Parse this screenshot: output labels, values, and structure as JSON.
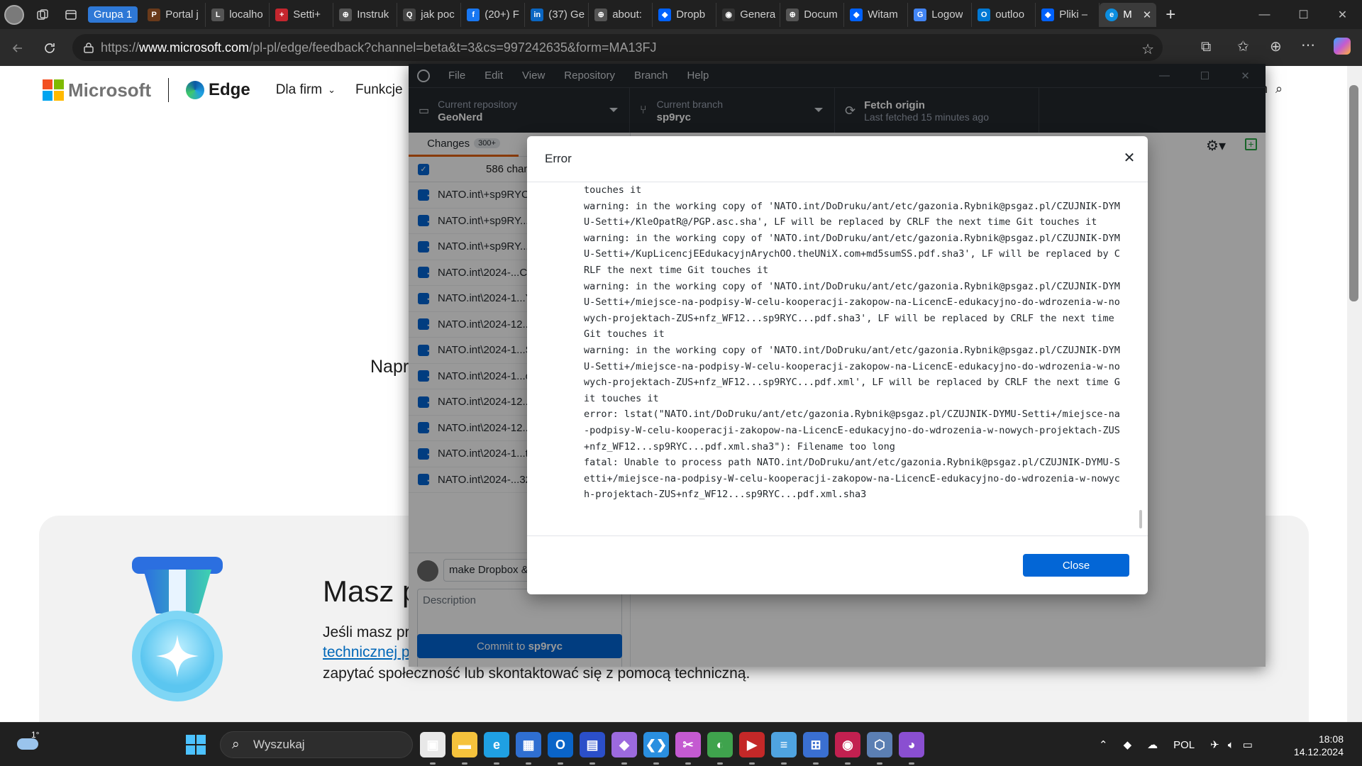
{
  "browser": {
    "group_label": "Grupa 1",
    "tabs": [
      {
        "label": "Portal j",
        "color": "#6a3a1a",
        "glyph": "P"
      },
      {
        "label": "localho",
        "color": "#555555",
        "glyph": "L"
      },
      {
        "label": "Setti+",
        "color": "#c4262e",
        "glyph": "+"
      },
      {
        "label": "Instruk",
        "color": "#555555",
        "glyph": "⊕"
      },
      {
        "label": "jak poc",
        "color": "#444444",
        "glyph": "Q"
      },
      {
        "label": "(20+) F",
        "color": "#1877f2",
        "glyph": "f"
      },
      {
        "label": "(37) Ge",
        "color": "#0a66c2",
        "glyph": "in"
      },
      {
        "label": "about:",
        "color": "#555555",
        "glyph": "⊕"
      },
      {
        "label": "Dropb",
        "color": "#0061fe",
        "glyph": "◆"
      },
      {
        "label": "Genera",
        "color": "#333333",
        "glyph": "◉"
      },
      {
        "label": "Docum",
        "color": "#555555",
        "glyph": "⊕"
      },
      {
        "label": "Witam",
        "color": "#0061fe",
        "glyph": "◆"
      },
      {
        "label": "Logow",
        "color": "#4285f4",
        "glyph": "G"
      },
      {
        "label": "outloo",
        "color": "#0078d4",
        "glyph": "O"
      },
      {
        "label": "Pliki –",
        "color": "#0061fe",
        "glyph": "◆"
      }
    ],
    "active_tab": {
      "label": "M",
      "color": "#0c8ee0",
      "glyph": "e"
    },
    "new_tab_label": "+",
    "url_prefix": "https://",
    "url_host": "www.microsoft.com",
    "url_path": "/pl-pl/edge/feedback?channel=beta&t=3&cs=997242635&form=MA13FJ"
  },
  "ms_page": {
    "brand": "Microsoft",
    "product": "Edge",
    "nav_items": [
      "Dla firm",
      "Funkcje"
    ],
    "search_fragment": "ch",
    "partial_heading": "Napr",
    "card_title": "Masz p",
    "card_line1": "Jeśli masz pr",
    "card_link": "technicznej p",
    "card_line3": "zapytać społeczność lub skontaktować się z pomocą techniczną."
  },
  "github_desktop": {
    "menus": [
      "File",
      "Edit",
      "View",
      "Repository",
      "Branch",
      "Help"
    ],
    "current_repository_label": "Current repository",
    "current_repository": "GeoNerd",
    "current_branch_label": "Current branch",
    "current_branch": "sp9ryc",
    "fetch_title": "Fetch origin",
    "fetch_sub": "Last fetched 15 minutes ago",
    "changes_tab": "Changes",
    "changes_count": "300+",
    "changes_header": "586 chang",
    "files": [
      "NATO.int\\+sp9RYC.e",
      "NATO.int\\+sp9RY...r",
      "NATO.int\\+sp9RY...u",
      "NATO.int\\2024-...Ci",
      "NATO.int\\2024-1...Y",
      "NATO.int\\2024-12...",
      "NATO.int\\2024-1...S",
      "NATO.int\\2024-1...o",
      "NATO.int\\2024-12...",
      "NATO.int\\2024-12...",
      "NATO.int\\2024-1...ta",
      "NATO.int\\2024-...32"
    ],
    "commit_summary": "make Dropbox &",
    "commit_description_placeholder": "Description",
    "commit_button_prefix": "Commit to ",
    "commit_button_branch": "sp9ryc"
  },
  "error_dialog": {
    "title": "Error",
    "lines": [
      "touches it",
      "warning: in the working copy of 'NATO.int/DoDruku/ant/etc/gazonia.Rybnik@psgaz.pl/CZUJNIK-DYMU-Setti+/KleOpatR@/PGP.asc.sha', LF will be replaced by CRLF the next time Git touches it",
      "warning: in the working copy of 'NATO.int/DoDruku/ant/etc/gazonia.Rybnik@psgaz.pl/CZUJNIK-DYMU-Setti+/KupLicencjEEdukacyjnArychOO.theUNiX.com+md5sumSS.pdf.sha3', LF will be replaced by CRLF the next time Git touches it",
      "warning: in the working copy of 'NATO.int/DoDruku/ant/etc/gazonia.Rybnik@psgaz.pl/CZUJNIK-DYMU-Setti+/miejsce-na-podpisy-W-celu-kooperacji-zakopow-na-LicencE-edukacyjno-do-wdrozenia-w-nowych-projektach-ZUS+nfz_WF12...sp9RYC...pdf.sha3', LF will be replaced by CRLF the next time Git touches it",
      "warning: in the working copy of 'NATO.int/DoDruku/ant/etc/gazonia.Rybnik@psgaz.pl/CZUJNIK-DYMU-Setti+/miejsce-na-podpisy-W-celu-kooperacji-zakopow-na-LicencE-edukacyjno-do-wdrozenia-w-nowych-projektach-ZUS+nfz_WF12...sp9RYC...pdf.xml', LF will be replaced by CRLF the next time Git touches it",
      "error: lstat(\"NATO.int/DoDruku/ant/etc/gazonia.Rybnik@psgaz.pl/CZUJNIK-DYMU-Setti+/miejsce-na-podpisy-W-celu-kooperacji-zakopow-na-LicencE-edukacyjno-do-wdrozenia-w-nowych-projektach-ZUS+nfz_WF12...sp9RYC...pdf.xml.sha3\"): Filename too long",
      "fatal: Unable to process path NATO.int/DoDruku/ant/etc/gazonia.Rybnik@psgaz.pl/CZUJNIK-DYMU-Setti+/miejsce-na-podpisy-W-celu-kooperacji-zakopow-na-LicencE-edukacyjno-do-wdrozenia-w-nowych-projektach-ZUS+nfz_WF12...sp9RYC...pdf.xml.sha3"
    ],
    "close_button": "Close"
  },
  "taskbar": {
    "weather_temp": "1°",
    "search_placeholder": "Wyszukaj",
    "language": "POL",
    "time": "18:08",
    "date": "14.12.2024",
    "apps": [
      {
        "name": "task-view-icon",
        "color": "#e8e8e8",
        "glyph": "▣"
      },
      {
        "name": "file-explorer-icon",
        "color": "#f5c23c",
        "glyph": "▬"
      },
      {
        "name": "edge-icon",
        "color": "#1fa0e3",
        "glyph": "e"
      },
      {
        "name": "store-icon",
        "color": "#2f6fd1",
        "glyph": "▦"
      },
      {
        "name": "outlook-icon",
        "color": "#0a64c8",
        "glyph": "O"
      },
      {
        "name": "save-app-icon",
        "color": "#2b4fc9",
        "glyph": "▤"
      },
      {
        "name": "paint-app-icon",
        "color": "#9c6ade",
        "glyph": "◆"
      },
      {
        "name": "vscode-icon",
        "color": "#2a8fe0",
        "glyph": "❮❯"
      },
      {
        "name": "snipping-tool-icon",
        "color": "#c45ad1",
        "glyph": "✂"
      },
      {
        "name": "globe-app-icon",
        "color": "#3fa34d",
        "glyph": "◐"
      },
      {
        "name": "media-app-icon",
        "color": "#c42828",
        "glyph": "▶"
      },
      {
        "name": "notepad-icon",
        "color": "#4fa3e0",
        "glyph": "≡"
      },
      {
        "name": "network-app-icon",
        "color": "#3a6fd1",
        "glyph": "⊞"
      },
      {
        "name": "raspberry-app-icon",
        "color": "#c22050",
        "glyph": "◉"
      },
      {
        "name": "virtualbox-icon",
        "color": "#5b7fb3",
        "glyph": "⬡"
      },
      {
        "name": "github-desktop-icon",
        "color": "#8a4fd1",
        "glyph": "◕"
      }
    ]
  }
}
